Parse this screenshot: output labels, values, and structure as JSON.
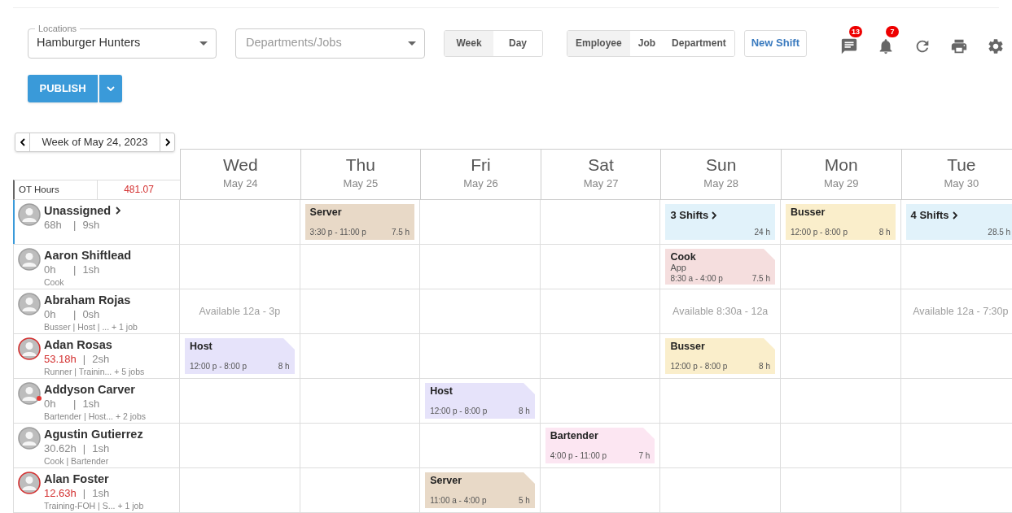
{
  "filters": {
    "location": {
      "label": "Locations",
      "value": "Hamburger Hunters"
    },
    "departments": {
      "placeholder": "Departments/Jobs"
    }
  },
  "view_toggle": [
    {
      "label": "Week",
      "selected": true
    },
    {
      "label": "Day",
      "selected": false
    }
  ],
  "group_toggle": [
    {
      "label": "Employee",
      "selected": true
    },
    {
      "label": "Job",
      "selected": false
    },
    {
      "label": "Department",
      "selected": false
    }
  ],
  "new_shift_button": "New Shift",
  "toolbar_icons": [
    {
      "kind": "messages",
      "badge": "13"
    },
    {
      "kind": "notifications",
      "badge": "7"
    },
    {
      "kind": "refresh"
    },
    {
      "kind": "print"
    },
    {
      "kind": "settings"
    }
  ],
  "publish_button": "PUBLISH",
  "week_label": "Week of May 24, 2023",
  "ot_hours": {
    "label": "OT Hours",
    "value": "481.07"
  },
  "days": [
    {
      "name": "Wed",
      "date": "May 24"
    },
    {
      "name": "Thu",
      "date": "May 25"
    },
    {
      "name": "Fri",
      "date": "May 26"
    },
    {
      "name": "Sat",
      "date": "May 27"
    },
    {
      "name": "Sun",
      "date": "May 28"
    },
    {
      "name": "Mon",
      "date": "May 29"
    },
    {
      "name": "Tue",
      "date": "May 30"
    }
  ],
  "employees": [
    {
      "name": "Unassigned",
      "hours": "68h",
      "separator": "|",
      "shifts": "9sh",
      "selected": true,
      "overtime": false,
      "alert": false,
      "expandable": true,
      "cells": [
        {
          "kind": "empty"
        },
        {
          "kind": "shift",
          "role": "Server",
          "time": "3:30 p - 11:00 p",
          "hours": "7.5 h",
          "color": "#e8d9c7",
          "flagged": false
        },
        {
          "kind": "empty"
        },
        {
          "kind": "empty"
        },
        {
          "kind": "group",
          "label": "3 Shifts",
          "hours": "24 h",
          "color": "#e1f2fa"
        },
        {
          "kind": "shift",
          "role": "Busser",
          "time": "12:00 p - 8:00 p",
          "hours": "8 h",
          "color": "#faeecb",
          "flagged": false
        },
        {
          "kind": "group",
          "label": "4 Shifts",
          "hours": "28.5 h",
          "color": "#e1f2fa"
        }
      ]
    },
    {
      "name": "Aaron Shiftlead",
      "hours": "0h",
      "separator": "|",
      "shifts": "1sh",
      "jobs": "Cook",
      "selected": false,
      "overtime": false,
      "alert": false,
      "expandable": false,
      "cells": [
        {
          "kind": "empty"
        },
        {
          "kind": "empty"
        },
        {
          "kind": "empty"
        },
        {
          "kind": "empty"
        },
        {
          "kind": "shift",
          "role": "Cook",
          "note": "App",
          "time": "8:30 a - 4:00 p",
          "hours": "7.5 h",
          "color": "#f5dede",
          "flagged": true
        },
        {
          "kind": "empty"
        },
        {
          "kind": "empty"
        }
      ]
    },
    {
      "name": "Abraham Rojas",
      "hours": "0h",
      "separator": "|",
      "shifts": "0sh",
      "jobs": "Busser | Host | ... + 1 job",
      "selected": false,
      "overtime": false,
      "alert": false,
      "expandable": false,
      "cells": [
        {
          "kind": "available",
          "text": "Available 12a - 3p"
        },
        {
          "kind": "empty"
        },
        {
          "kind": "empty"
        },
        {
          "kind": "empty"
        },
        {
          "kind": "available",
          "text": "Available 8:30a - 12a"
        },
        {
          "kind": "empty"
        },
        {
          "kind": "available",
          "text": "Available 12a - 7:30p"
        }
      ]
    },
    {
      "name": "Adan Rosas",
      "hours": "53.18h",
      "separator": "|",
      "shifts": "2sh",
      "jobs": "Runner | Trainin... + 5 jobs",
      "selected": false,
      "overtime": true,
      "alert": false,
      "expandable": false,
      "cells": [
        {
          "kind": "shift",
          "role": "Host",
          "time": "12:00 p - 8:00 p",
          "hours": "8 h",
          "color": "#e6e3fa",
          "flagged": true
        },
        {
          "kind": "empty"
        },
        {
          "kind": "empty"
        },
        {
          "kind": "empty"
        },
        {
          "kind": "shift",
          "role": "Busser",
          "time": "12:00 p - 8:00 p",
          "hours": "8 h",
          "color": "#faeecb",
          "flagged": true
        },
        {
          "kind": "empty"
        },
        {
          "kind": "empty"
        }
      ]
    },
    {
      "name": "Addyson Carver",
      "hours": "0h",
      "separator": "|",
      "shifts": "1sh",
      "jobs": "Bartender | Host... + 2 jobs",
      "selected": false,
      "overtime": false,
      "alert": true,
      "expandable": false,
      "cells": [
        {
          "kind": "empty"
        },
        {
          "kind": "empty"
        },
        {
          "kind": "shift",
          "role": "Host",
          "time": "12:00 p - 8:00 p",
          "hours": "8 h",
          "color": "#e6e3fa",
          "flagged": true
        },
        {
          "kind": "empty"
        },
        {
          "kind": "empty"
        },
        {
          "kind": "empty"
        },
        {
          "kind": "empty"
        }
      ]
    },
    {
      "name": "Agustin Gutierrez",
      "hours": "30.62h",
      "separator": "|",
      "shifts": "1sh",
      "jobs": "Cook | Bartender",
      "selected": false,
      "overtime": false,
      "alert": false,
      "expandable": false,
      "cells": [
        {
          "kind": "empty"
        },
        {
          "kind": "empty"
        },
        {
          "kind": "empty"
        },
        {
          "kind": "shift",
          "role": "Bartender",
          "time": "4:00 p - 11:00 p",
          "hours": "7 h",
          "color": "#fce6f2",
          "flagged": true
        },
        {
          "kind": "empty"
        },
        {
          "kind": "empty"
        },
        {
          "kind": "empty"
        }
      ]
    },
    {
      "name": "Alan Foster",
      "hours": "12.63h",
      "separator": "|",
      "shifts": "1sh",
      "jobs": "Training-FOH | S... + 1 job",
      "selected": false,
      "overtime": true,
      "alert": false,
      "expandable": false,
      "cells": [
        {
          "kind": "empty"
        },
        {
          "kind": "empty"
        },
        {
          "kind": "shift",
          "role": "Server",
          "time": "11:00 a - 4:00 p",
          "hours": "5 h",
          "color": "#e8d9c7",
          "flagged": true
        },
        {
          "kind": "empty"
        },
        {
          "kind": "empty"
        },
        {
          "kind": "empty"
        },
        {
          "kind": "empty"
        }
      ]
    }
  ]
}
